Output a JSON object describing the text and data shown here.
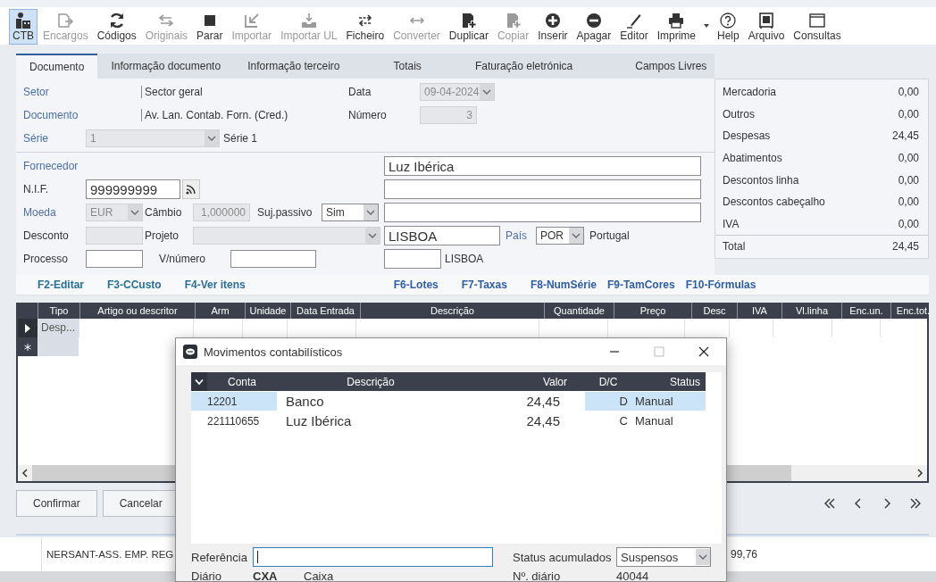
{
  "toolbar": [
    {
      "label": "CTB",
      "selected": true,
      "disabled": false
    },
    {
      "label": "Encargos",
      "selected": false,
      "disabled": true
    },
    {
      "label": "Códigos",
      "selected": false,
      "disabled": false
    },
    {
      "label": "Originais",
      "selected": false,
      "disabled": true
    },
    {
      "label": "Parar",
      "selected": false,
      "disabled": false
    },
    {
      "label": "Importar",
      "selected": false,
      "disabled": true
    },
    {
      "label": "Importar UL",
      "selected": false,
      "disabled": true
    },
    {
      "label": "Ficheiro",
      "selected": false,
      "disabled": false
    },
    {
      "label": "Converter",
      "selected": false,
      "disabled": true
    },
    {
      "label": "Duplicar",
      "selected": false,
      "disabled": false
    },
    {
      "label": "Copiar",
      "selected": false,
      "disabled": true
    },
    {
      "label": "Inserir",
      "selected": false,
      "disabled": false
    },
    {
      "label": "Apagar",
      "selected": false,
      "disabled": false
    },
    {
      "label": "Editor",
      "selected": false,
      "disabled": false
    },
    {
      "label": "Imprime",
      "selected": false,
      "disabled": false
    },
    {
      "label": "Help",
      "selected": false,
      "disabled": false
    },
    {
      "label": "Arquivo",
      "selected": false,
      "disabled": false
    },
    {
      "label": "Consultas",
      "selected": false,
      "disabled": false
    }
  ],
  "tabs": [
    {
      "label": "Documento",
      "selected": true
    },
    {
      "label": "Informação documento",
      "selected": false
    },
    {
      "label": "Informação terceiro",
      "selected": false
    },
    {
      "label": "Totais",
      "selected": false
    },
    {
      "label": "Faturação eletrónica",
      "selected": false
    },
    {
      "label": "Campos Livres",
      "selected": false
    }
  ],
  "document": {
    "setor": {
      "label": "Setor",
      "link": true,
      "value": "Sector geral"
    },
    "documento": {
      "label": "Documento",
      "link": true,
      "value": "Av. Lan. Contab. Forn. (Cred.)"
    },
    "serie": {
      "label": "Série",
      "link": true,
      "value": "1",
      "description": "Série 1",
      "disabled": true
    },
    "data": {
      "label": "Data",
      "link": false,
      "value": "09-04-2024",
      "disabled": true
    },
    "numero": {
      "label": "Número",
      "link": false,
      "value": "3",
      "disabled": true
    }
  },
  "supplier": {
    "fornecedor": {
      "label": "Fornecedor",
      "link": true
    },
    "nif": {
      "label": "N.I.F.",
      "link": false,
      "value": "999999999"
    },
    "moeda": {
      "label": "Moeda",
      "link": true,
      "value": "EUR",
      "disabled": true
    },
    "cambio": {
      "label": "Câmbio",
      "link": false,
      "value": "1,000000",
      "disabled": true
    },
    "suj_passivo": {
      "label": "Suj.passivo",
      "link": false,
      "value": "Sim",
      "disabled": false
    },
    "desconto": {
      "label": "Desconto",
      "link": false,
      "disabled": true
    },
    "projeto": {
      "label": "Projeto",
      "link": false,
      "disabled": true
    },
    "processo": {
      "label": "Processo",
      "link": false,
      "disabled": false
    },
    "v_numero": {
      "label": "V/número",
      "link": false,
      "disabled": false
    },
    "name": "Luz Ibérica",
    "city": "LISBOA",
    "pais": {
      "label": "País",
      "link": true,
      "code": "POR",
      "name": "Portugal"
    },
    "locality": "LISBOA"
  },
  "totals": {
    "rows": [
      {
        "label": "Mercadoria",
        "value": "0,00"
      },
      {
        "label": "Outros",
        "value": "0,00"
      },
      {
        "label": "Despesas",
        "value": "24,45"
      },
      {
        "label": "Abatimentos",
        "value": "0,00"
      },
      {
        "label": "Descontos linha",
        "value": "0,00"
      },
      {
        "label": "Descontos cabeçalho",
        "value": "0,00"
      },
      {
        "label": "IVA",
        "value": "0,00"
      }
    ],
    "total": {
      "label": "Total",
      "value": "24,45"
    }
  },
  "function_keys": [
    "F2-Editar",
    "F3-CCusto",
    "F4-Ver itens",
    "F6-Lotes",
    "F7-Taxas",
    "F8-NumSérie",
    "F9-TamCores",
    "F10-Fórmulas"
  ],
  "grid": {
    "columns": [
      "Tipo",
      "Artigo ou descritor",
      "Arm",
      "Unidade",
      "Data Entrada",
      "Descrição",
      "Quantidade",
      "Preço",
      "Desc",
      "IVA",
      "Vl.linha",
      "Enc.un.",
      "Enc.tot."
    ],
    "rows": [
      {
        "cells": [
          "Desp..."
        ],
        "current": true
      }
    ]
  },
  "buttons": [
    "Confirmar",
    "Cancelar"
  ],
  "background_window": {
    "rows": [
      {
        "cells": [
          "NERSANT-ASS. EMP. REG",
          "99,76"
        ]
      }
    ]
  },
  "dialog": {
    "title": "Movimentos contabilísticos",
    "columns": [
      "Conta",
      "Descrição",
      "Valor",
      "D/C",
      "Status"
    ],
    "rows": [
      {
        "conta": "12201",
        "descricao": "Banco",
        "valor": "24,45",
        "dc": "D",
        "status": "Manual",
        "selected": true
      },
      {
        "conta": "221110655",
        "descricao": "Luz Ibérica",
        "valor": "24,45",
        "dc": "C",
        "status": "Manual",
        "selected": false
      }
    ],
    "referencia": {
      "label": "Referência",
      "focused": true
    },
    "status_acumulados": {
      "label": "Status acumulados",
      "value": "Suspensos"
    },
    "diario": {
      "label": "Diário",
      "code": "CXA",
      "name": "Caixa"
    },
    "n_diario": {
      "label": "Nº. diário",
      "value": "40044"
    }
  }
}
